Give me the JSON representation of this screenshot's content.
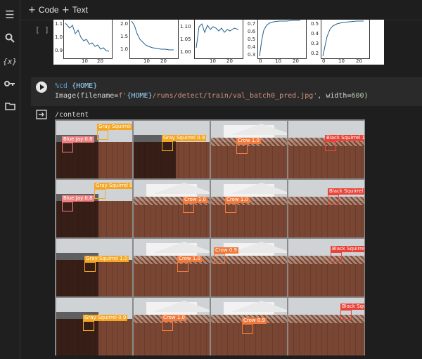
{
  "toolbar": {
    "code_label": "Code",
    "text_label": "Text"
  },
  "sidebar": {
    "icons": [
      "menu-icon",
      "search-icon",
      "variables-icon",
      "key-icon",
      "folder-icon"
    ],
    "variables_glyph": "{x}"
  },
  "prev_cell": {
    "bracket": "[ ]",
    "plots": [
      {
        "y_ticks": [
          "1.1",
          "1.0",
          "0.9"
        ],
        "x_ticks": [
          "10",
          "20"
        ]
      },
      {
        "y_ticks": [
          "2.0",
          "1.5",
          "1.0"
        ],
        "x_ticks": [
          "10",
          "20"
        ]
      },
      {
        "y_ticks": [
          "1.10",
          "1.05",
          "1.00"
        ],
        "x_ticks": [
          "10",
          "20"
        ]
      },
      {
        "y_ticks": [
          "0.7",
          "0.6",
          "0.5",
          "0.4",
          "0.3"
        ],
        "x_ticks": [
          "0",
          "10",
          "20"
        ]
      },
      {
        "y_ticks": [
          "0.5",
          "0.4",
          "0.3",
          "0.2"
        ],
        "x_ticks": [
          "0",
          "10",
          "20"
        ]
      }
    ]
  },
  "active_cell": {
    "line1_magic": "%cd ",
    "line1_var": "{HOME}",
    "line2_a": "Image(filename=",
    "line2_b": "f'",
    "line2_c": "{HOME}",
    "line2_d": "/runs/detect/train/val_batch0_pred.jpg'",
    "line2_e": ", width=",
    "line2_f": "600",
    "line2_g": ")"
  },
  "output": {
    "text": "/content"
  },
  "colors": {
    "gray_squirrel": "#f5a623",
    "blue_jay": "#f08080",
    "crow": "#f07a3c",
    "black_squirrel": "#e8443a"
  },
  "tiles": [
    {
      "scene": "shadow",
      "labels": [
        {
          "t": "Gray Squirrel 1.0",
          "c": "gray_squirrel"
        },
        {
          "t": "Blue Jay 0.8",
          "c": "blue_jay"
        }
      ]
    },
    {
      "scene": "shadow",
      "labels": [
        {
          "t": "Gray Squirrel 0.9",
          "c": "gray_squirrel"
        }
      ]
    },
    {
      "scene": "house",
      "labels": [
        {
          "t": "Crow 1.0",
          "c": "crow"
        }
      ]
    },
    {
      "scene": "fence",
      "labels": [
        {
          "t": "Black Squirrel 1.0",
          "c": "black_squirrel"
        }
      ]
    },
    {
      "scene": "shadow",
      "labels": [
        {
          "t": "Gray Squirrel 0.9",
          "c": "gray_squirrel"
        },
        {
          "t": "Blue Jay 0.8",
          "c": "blue_jay"
        }
      ]
    },
    {
      "scene": "house",
      "labels": [
        {
          "t": "Crow 1.0",
          "c": "crow"
        }
      ]
    },
    {
      "scene": "house",
      "labels": [
        {
          "t": "Crow 1.0",
          "c": "crow"
        }
      ]
    },
    {
      "scene": "fence",
      "labels": [
        {
          "t": "Black Squirrel 0.8",
          "c": "black_squirrel"
        }
      ]
    },
    {
      "scene": "shadow",
      "labels": [
        {
          "t": "Gray Squirrel 1.0",
          "c": "gray_squirrel"
        }
      ]
    },
    {
      "scene": "house",
      "labels": [
        {
          "t": "Crow 1.0",
          "c": "crow"
        }
      ]
    },
    {
      "scene": "house",
      "labels": [
        {
          "t": "Crow 0.9",
          "c": "crow"
        }
      ]
    },
    {
      "scene": "fence",
      "labels": [
        {
          "t": "Black Squirrel",
          "c": "black_squirrel"
        }
      ]
    },
    {
      "scene": "shadow",
      "labels": [
        {
          "t": "Gray Squirrel 0.9",
          "c": "gray_squirrel"
        }
      ]
    },
    {
      "scene": "house",
      "labels": [
        {
          "t": "Crow 1.0",
          "c": "crow"
        }
      ]
    },
    {
      "scene": "house",
      "labels": [
        {
          "t": "Crow 0.9",
          "c": "crow"
        }
      ]
    },
    {
      "scene": "fence",
      "labels": [
        {
          "t": "Black Squ",
          "c": "black_squirrel"
        }
      ]
    }
  ]
}
